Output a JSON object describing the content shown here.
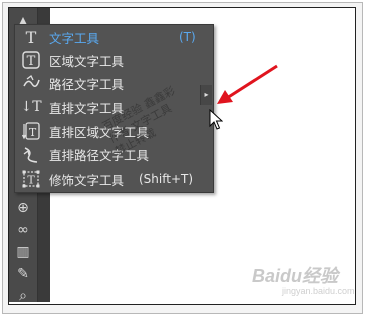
{
  "flyout": {
    "items": [
      {
        "icon": "type-icon",
        "glyph": "T",
        "label": "文字工具",
        "shortcut": "(T)",
        "active": true
      },
      {
        "icon": "area-type-icon",
        "glyph": "T",
        "label": "区域文字工具",
        "shortcut": "",
        "active": false
      },
      {
        "icon": "type-on-path-icon",
        "glyph": "✓",
        "label": "路径文字工具",
        "shortcut": "",
        "active": false
      },
      {
        "icon": "vertical-type-icon",
        "glyph": "↓T",
        "label": "直排文字工具",
        "shortcut": "",
        "active": false
      },
      {
        "icon": "vertical-area-type-icon",
        "glyph": "↓T",
        "label": "直排区域文字工具",
        "shortcut": "",
        "active": false
      },
      {
        "icon": "vertical-type-on-path-icon",
        "glyph": "✓",
        "label": "直排路径文字工具",
        "shortcut": "",
        "active": false
      },
      {
        "icon": "touch-type-icon",
        "glyph": "T",
        "label": "修饰文字工具",
        "shortcut": "(Shift+T)",
        "active": false
      }
    ],
    "tearoff_glyph": "▸"
  },
  "watermark": {
    "lines": [
      "百度经验 鑫鑫彩",
      "作者 文字工具",
      "禁止转载"
    ]
  },
  "baidu_logo": {
    "text": "Baidu经验",
    "sub": "jingyan.baidu.com"
  },
  "colors": {
    "active_text": "#5aa9f0",
    "panel_bg": "#535353",
    "arrow": "#e0141e"
  }
}
